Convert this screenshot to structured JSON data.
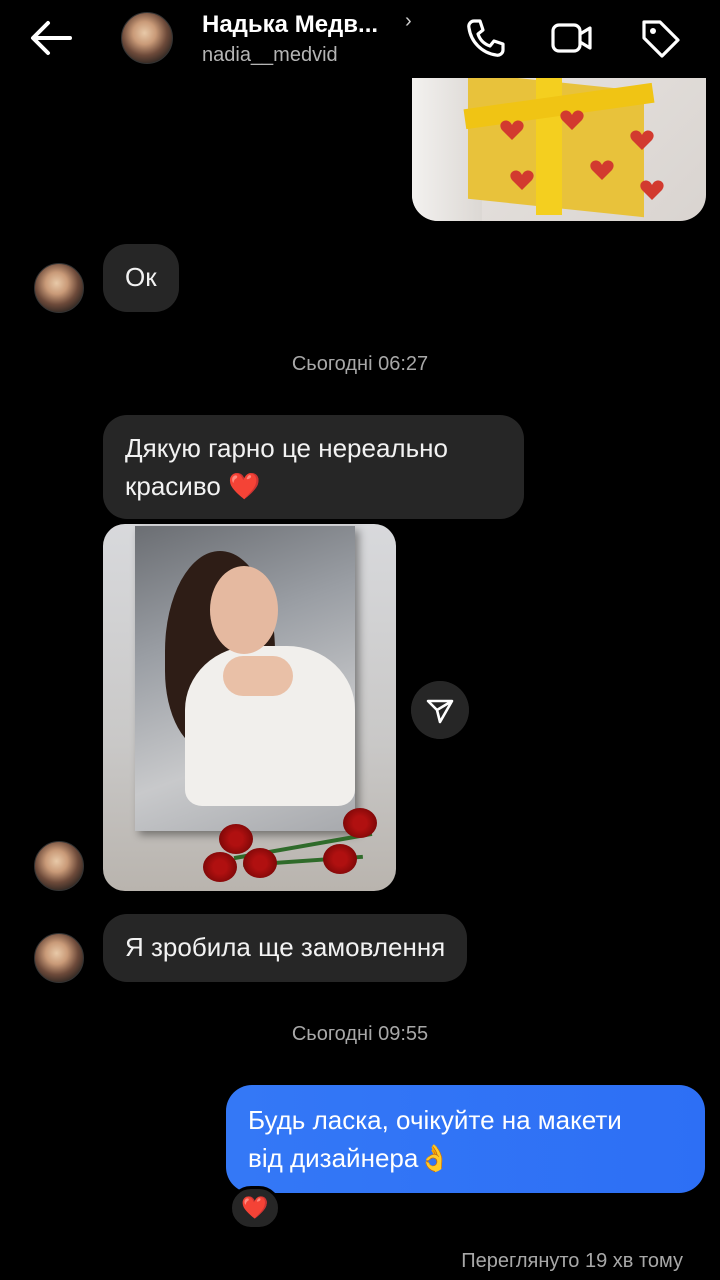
{
  "header": {
    "name": "Надька Медв...",
    "chevron": "›",
    "username": "nadia__medvid",
    "icons": [
      "back-arrow-icon",
      "phone-icon",
      "video-camera-icon",
      "tag-icon"
    ]
  },
  "messages": {
    "ok": "Ок",
    "ts1": "Сьогодні 06:27",
    "thanks_line1": "Дякую гарно це нереально",
    "thanks_line2": "красиво",
    "thanks_emoji": "❤️",
    "order": "Я зробила ще замовлення",
    "ts2": "Сьогодні 09:55",
    "reply_line1": "Будь ласка, очікуйте на макети",
    "reply_line2": "від дизайнера",
    "reply_emoji": "👌",
    "reaction": "❤️",
    "seen": "Переглянуто 19 хв тому"
  },
  "colors": {
    "background": "#000000",
    "incoming_bubble": "#262626",
    "outgoing_bubble": "#3478f6",
    "muted_text": "#a8a8a8",
    "heart": "#e0242f"
  }
}
